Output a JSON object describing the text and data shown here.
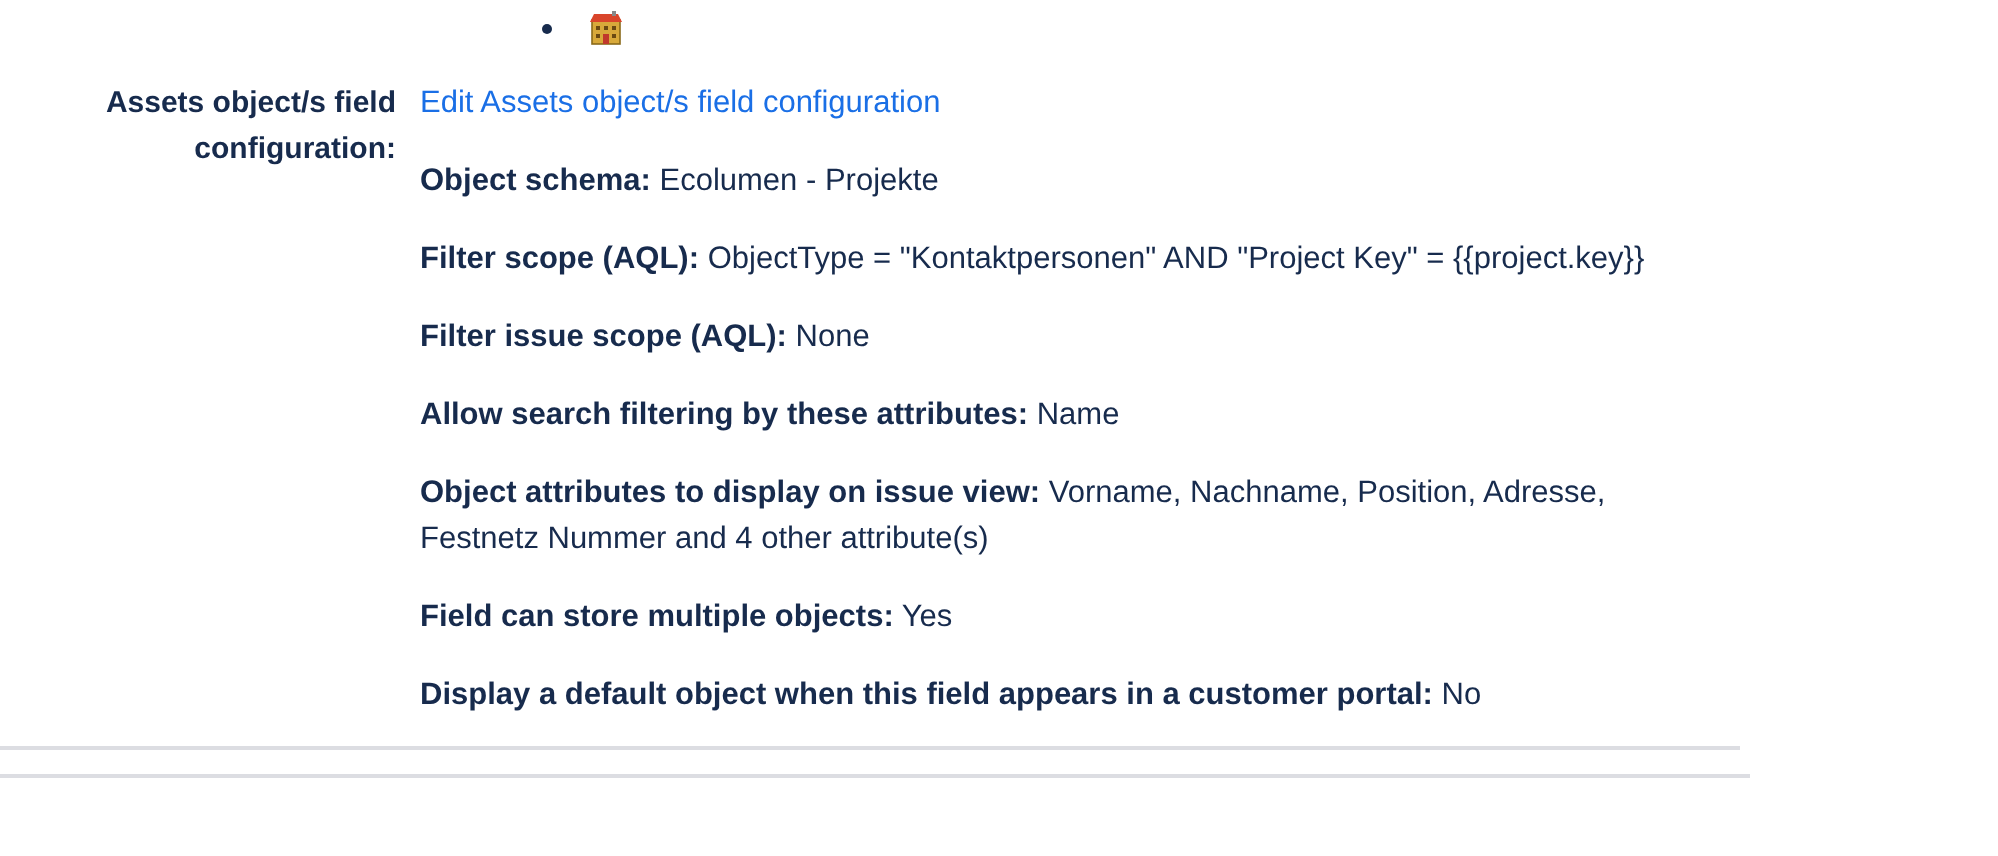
{
  "field": {
    "label": "Assets object/s field configuration:",
    "link": "Edit Assets object/s field configuration",
    "details": [
      {
        "label": "Object schema:",
        "value": "Ecolumen - Projekte"
      },
      {
        "label": "Filter scope (AQL):",
        "value": "ObjectType = \"Kontaktpersonen\" AND \"Project Key\" = {{project.key}}"
      },
      {
        "label": "Filter issue scope (AQL):",
        "value": "None"
      },
      {
        "label": "Allow search filtering by these attributes:",
        "value": "Name"
      },
      {
        "label": "Object attributes to display on issue view:",
        "value": "Vorname, Nachname, Position, Adresse, Festnetz Nummer and 4 other attribute(s)"
      },
      {
        "label": "Field can store multiple objects:",
        "value": "Yes"
      },
      {
        "label": "Display a default object when this field appears in a customer portal:",
        "value": "No"
      }
    ]
  }
}
